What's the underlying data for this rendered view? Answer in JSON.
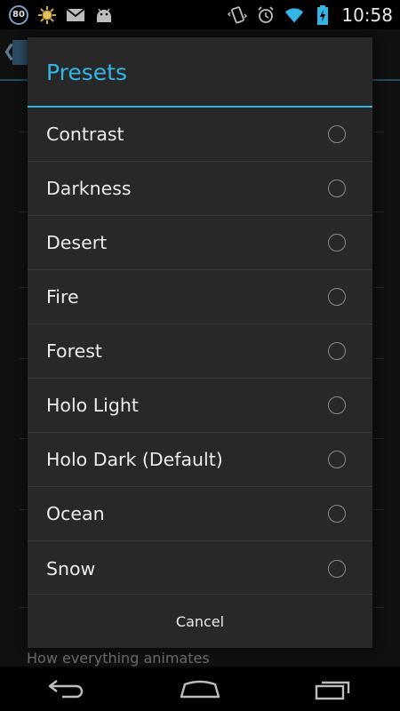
{
  "status_bar": {
    "notification_count": "80",
    "time": "10:58",
    "left_icons": [
      "notification-count-icon",
      "sun-icon",
      "gmail-icon",
      "android-icon"
    ],
    "right_icons": [
      "vibrate-icon",
      "alarm-icon",
      "wifi-icon",
      "battery-charging-icon"
    ]
  },
  "background": {
    "partial_text": "How everything animates"
  },
  "dialog": {
    "title": "Presets",
    "items": [
      {
        "label": "Contrast"
      },
      {
        "label": "Darkness"
      },
      {
        "label": "Desert"
      },
      {
        "label": "Fire"
      },
      {
        "label": "Forest"
      },
      {
        "label": "Holo Light"
      },
      {
        "label": "Holo Dark (Default)"
      },
      {
        "label": "Ocean"
      },
      {
        "label": "Snow"
      }
    ],
    "cancel_label": "Cancel"
  },
  "nav_bar": {
    "buttons": [
      "back-icon",
      "home-icon",
      "recent-apps-icon"
    ]
  },
  "colors": {
    "accent": "#33b5e5",
    "dialog_bg": "#282828",
    "divider": "#3a3a3a"
  }
}
